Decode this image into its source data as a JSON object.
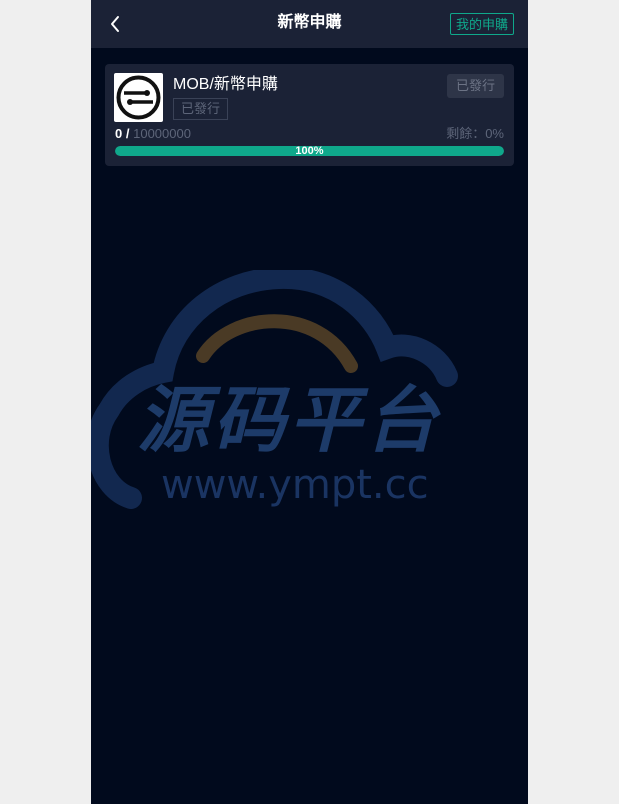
{
  "header": {
    "back_icon": "chevron-left-icon",
    "title": "新幣申購",
    "my_subscriptions_label": "我的申購"
  },
  "card": {
    "logo_icon": "mob-coin-logo-icon",
    "name": "MOB/新幣申購",
    "status_tag": "已發行",
    "status_button": "已發行",
    "sold": "0",
    "separator": "/",
    "total": "10000000",
    "remaining_label": "剩餘：0%",
    "progress_percent": 100,
    "progress_text": "100%"
  },
  "watermark": {
    "chinese": "源码平台",
    "url": "www.ympt.cc"
  },
  "colors": {
    "accent": "#0fa88b",
    "panel": "#1b2236",
    "background": "#010a1d"
  }
}
